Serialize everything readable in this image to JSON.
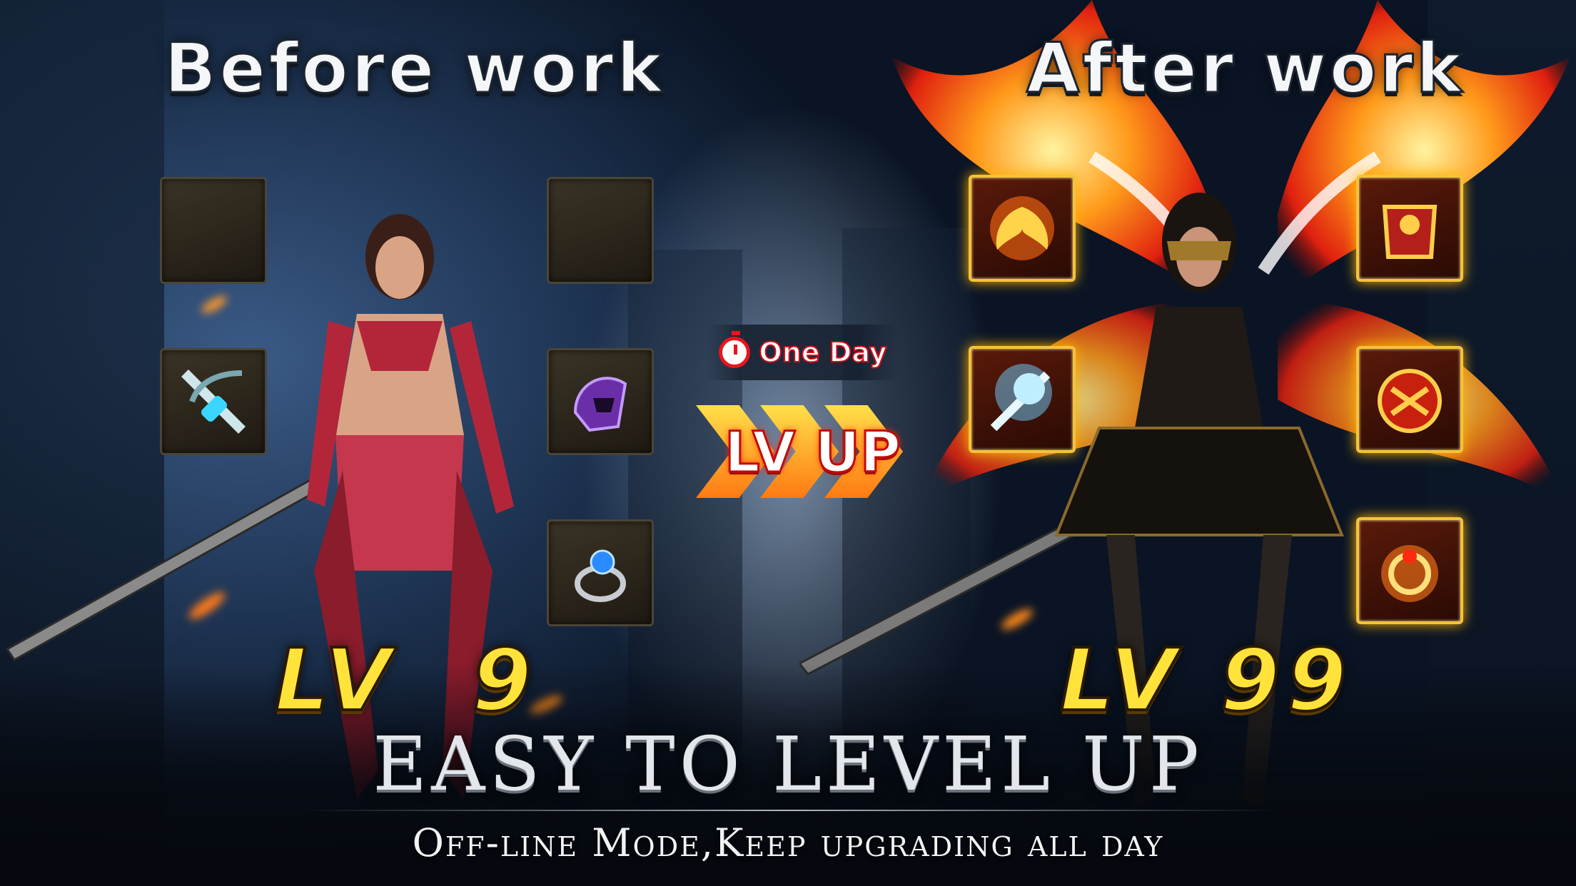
{
  "headers": {
    "before": "Before work",
    "after": "After work"
  },
  "timer": {
    "icon": "stopwatch-icon",
    "label": "One Day"
  },
  "lvup": {
    "label": "LV UP"
  },
  "levels": {
    "before": "LV  9",
    "after": "LV 99"
  },
  "slogan": {
    "main": "EASY TO LEVEL UP",
    "sub": "Off-line Mode,Keep upgrading all day"
  },
  "equipment": {
    "before": [
      {
        "slot": "top-left",
        "item": "empty"
      },
      {
        "slot": "mid-left",
        "item": "crossbow-icon"
      },
      {
        "slot": "top-right",
        "item": "empty"
      },
      {
        "slot": "mid-right",
        "item": "purple-helmet-icon"
      },
      {
        "slot": "bottom-right",
        "item": "blue-gem-ring-icon"
      }
    ],
    "after": [
      {
        "slot": "top-left",
        "item": "phoenix-icon"
      },
      {
        "slot": "mid-left",
        "item": "ice-crossbow-icon"
      },
      {
        "slot": "top-right",
        "item": "gold-armor-icon"
      },
      {
        "slot": "mid-right",
        "item": "flame-helmet-icon"
      },
      {
        "slot": "bottom-right",
        "item": "fire-ring-icon"
      }
    ]
  },
  "colors": {
    "level_text": "#ffe33a",
    "lvup_fill": "#ff7a12",
    "timer_red": "#e8141e",
    "gold_frame": "#f5c23a"
  }
}
